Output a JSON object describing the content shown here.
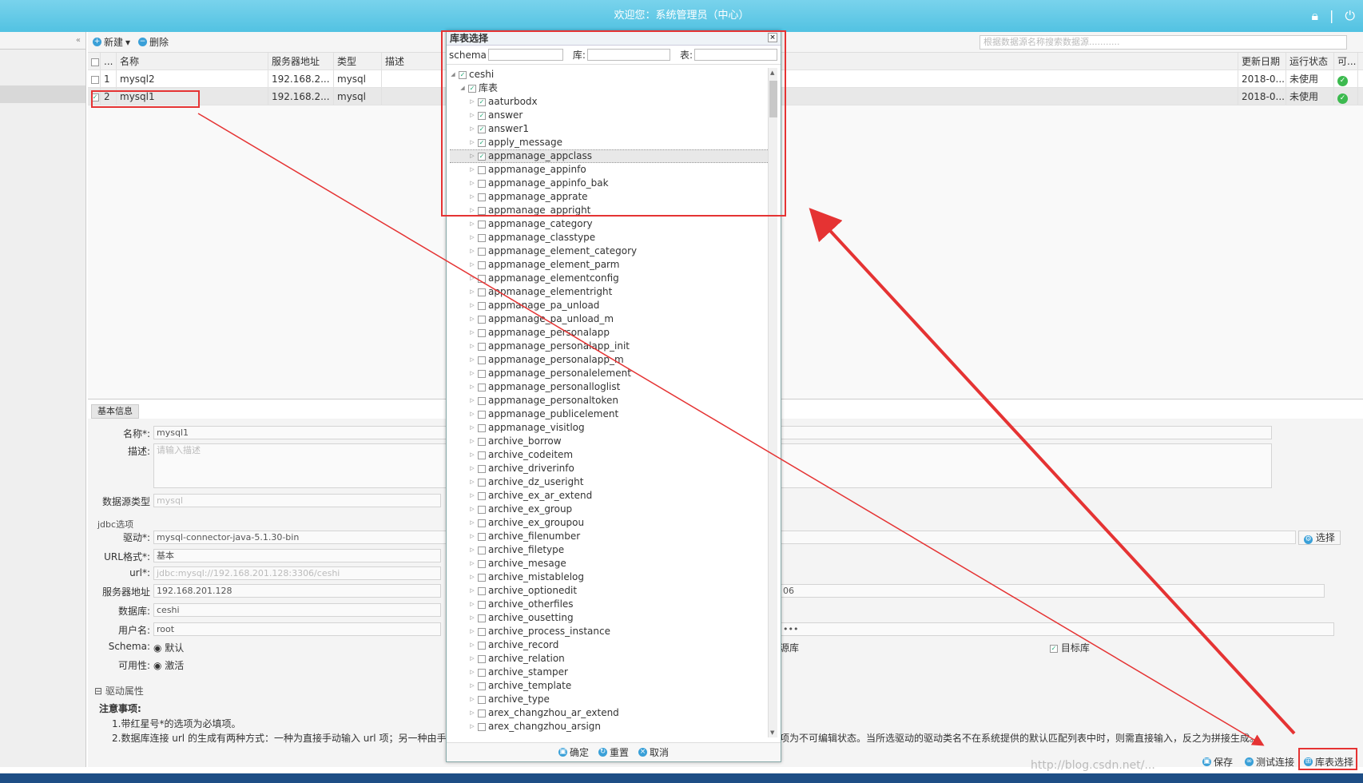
{
  "header": {
    "title": "欢迎您：系统管理员（中心）"
  },
  "toolbar": {
    "new_label": "新建",
    "delete_label": "删除",
    "search_placeholder": "根据数据源名称搜索数据源..........."
  },
  "grid": {
    "columns": [
      "名称",
      "服务器地址",
      "类型",
      "描述",
      "更新日期",
      "运行状态",
      "可..."
    ],
    "rows": [
      {
        "index": "1",
        "name": "mysql2",
        "server": "192.168.2...",
        "type": "mysql",
        "date": "2018-0...",
        "status": "未使用",
        "checked": ""
      },
      {
        "index": "2",
        "name": "mysql1",
        "server": "192.168.2...",
        "type": "mysql",
        "date": "2018-0...",
        "status": "未使用",
        "checked": "✓"
      }
    ]
  },
  "form": {
    "tab_label": "基本信息",
    "name_label": "名称*:",
    "name_value": "mysql1",
    "desc_label": "描述:",
    "desc_placeholder": "请输入描述",
    "dstype_label": "数据源类型",
    "dstype_value": "mysql",
    "jdbc_legend": "jdbc选项",
    "driver_label": "驱动*:",
    "driver_value": "mysql-connector-java-5.1.30-bin",
    "choose_label": "选择",
    "urlformat_label": "URL格式*:",
    "urlformat_value": "基本",
    "url_label": "url*:",
    "url_value": "jdbc:mysql://192.168.201.128:3306/ceshi",
    "server_label": "服务器地址",
    "server_value": "192.168.201.128",
    "port_value": "06",
    "db_label": "数据库:",
    "db_value": "ceshi",
    "user_label": "用户名:",
    "user_value": "root",
    "password_value": "•••",
    "schema_label": "Schema:",
    "schema_value": "默认",
    "avail_label": "可用性:",
    "avail_value": "激活",
    "source_label": "源库",
    "target_label": "目标库",
    "driver_props": "驱动属性",
    "notes_title": "注意事项:",
    "note1": "1.带红星号*的选项为必填项。",
    "note2_left": "2.数据库连接 url 的生成有两种方式：一种为直接手动输入 url 项；另一种由手动",
    "note2_right": "项为不可编辑状态。当所选驱动的驱动类名不在系统提供的默认匹配列表中时，则需直接输入，反之为拼接生成。"
  },
  "bottom": {
    "save_label": "保存",
    "test_label": "测试连接",
    "table_select_label": "库表选择",
    "watermark": "http://blog.csdn.net/..."
  },
  "dialog": {
    "title": "库表选择",
    "filter_schema_label": "schema",
    "filter_db_label": "库:",
    "filter_table_label": "表:",
    "root": "ceshi",
    "group": "库表",
    "items": [
      {
        "label": "aaturbodx",
        "checked": true
      },
      {
        "label": "answer",
        "checked": true
      },
      {
        "label": "answer1",
        "checked": true
      },
      {
        "label": "apply_message",
        "checked": true
      },
      {
        "label": "appmanage_appclass",
        "checked": true,
        "highlight": true
      },
      {
        "label": "appmanage_appinfo",
        "checked": false
      },
      {
        "label": "appmanage_appinfo_bak",
        "checked": false
      },
      {
        "label": "appmanage_apprate",
        "checked": false
      },
      {
        "label": "appmanage_appright",
        "checked": false
      },
      {
        "label": "appmanage_category",
        "checked": false
      },
      {
        "label": "appmanage_classtype",
        "checked": false
      },
      {
        "label": "appmanage_element_category",
        "checked": false
      },
      {
        "label": "appmanage_element_parm",
        "checked": false
      },
      {
        "label": "appmanage_elementconfig",
        "checked": false
      },
      {
        "label": "appmanage_elementright",
        "checked": false
      },
      {
        "label": "appmanage_pa_unload",
        "checked": false
      },
      {
        "label": "appmanage_pa_unload_m",
        "checked": false
      },
      {
        "label": "appmanage_personalapp",
        "checked": false
      },
      {
        "label": "appmanage_personalapp_init",
        "checked": false
      },
      {
        "label": "appmanage_personalapp_m",
        "checked": false
      },
      {
        "label": "appmanage_personalelement",
        "checked": false
      },
      {
        "label": "appmanage_personalloglist",
        "checked": false
      },
      {
        "label": "appmanage_personaltoken",
        "checked": false
      },
      {
        "label": "appmanage_publicelement",
        "checked": false
      },
      {
        "label": "appmanage_visitlog",
        "checked": false
      },
      {
        "label": "archive_borrow",
        "checked": false
      },
      {
        "label": "archive_codeitem",
        "checked": false
      },
      {
        "label": "archive_driverinfo",
        "checked": false
      },
      {
        "label": "archive_dz_useright",
        "checked": false
      },
      {
        "label": "archive_ex_ar_extend",
        "checked": false
      },
      {
        "label": "archive_ex_group",
        "checked": false
      },
      {
        "label": "archive_ex_groupou",
        "checked": false
      },
      {
        "label": "archive_filenumber",
        "checked": false
      },
      {
        "label": "archive_filetype",
        "checked": false
      },
      {
        "label": "archive_mesage",
        "checked": false
      },
      {
        "label": "archive_mistablelog",
        "checked": false
      },
      {
        "label": "archive_optionedit",
        "checked": false
      },
      {
        "label": "archive_otherfiles",
        "checked": false
      },
      {
        "label": "archive_ousetting",
        "checked": false
      },
      {
        "label": "archive_process_instance",
        "checked": false
      },
      {
        "label": "archive_record",
        "checked": false
      },
      {
        "label": "archive_relation",
        "checked": false
      },
      {
        "label": "archive_stamper",
        "checked": false
      },
      {
        "label": "archive_template",
        "checked": false
      },
      {
        "label": "archive_type",
        "checked": false
      },
      {
        "label": "arex_changzhou_ar_extend",
        "checked": false
      },
      {
        "label": "arex_changzhou_arsign",
        "checked": false
      }
    ],
    "ok_label": "确定",
    "reset_label": "重置",
    "cancel_label": "取消"
  },
  "colors": {
    "header": "#5ac6e4",
    "annotation": "#e53333",
    "ok_green": "#3cba4f",
    "accent": "#3aa0d8"
  }
}
